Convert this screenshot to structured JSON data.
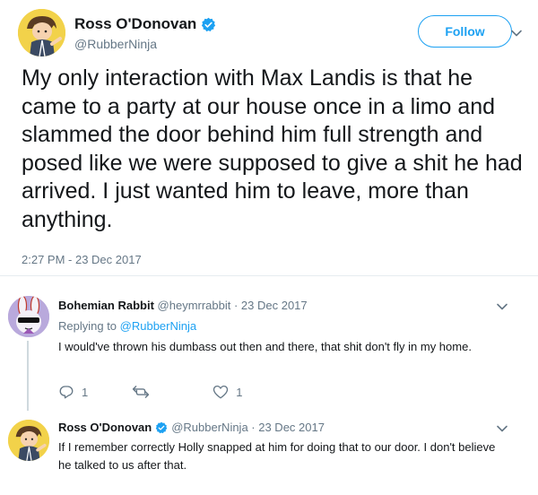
{
  "tweet": {
    "author_name": "Ross O'Donovan",
    "handle": "@RubberNinja",
    "follow_label": "Follow",
    "text": "My only interaction with Max Landis is that he came to a party at our house once in a limo and slammed the door behind him full strength and posed like we were supposed to give a shit he had arrived. I just wanted him to leave, more than anything.",
    "timestamp": "2:27 PM - 23 Dec 2017"
  },
  "replies": [
    {
      "name": "Bohemian Rabbit",
      "meta": "@heymrrabbit · 23 Dec 2017",
      "replying_prefix": "Replying to ",
      "replying_mention": "@RubberNinja",
      "text": "I would've thrown his dumbass out then and there, that shit don't fly in my home.",
      "reply_count": "1",
      "retweet_count": "",
      "like_count": "1"
    },
    {
      "name": "Ross O'Donovan",
      "meta": "@RubberNinja · 23 Dec 2017",
      "text": "If I remember correctly Holly snapped at him for doing that to our door. I don't believe he talked to us after that."
    }
  ],
  "colors": {
    "accent": "#1da1f2",
    "secondary_text": "#657786",
    "primary_text": "#14171a",
    "divider": "#e6ecf0"
  },
  "icons": [
    "verified-badge-icon",
    "chevron-down-icon",
    "reply-icon",
    "retweet-icon",
    "like-icon"
  ]
}
